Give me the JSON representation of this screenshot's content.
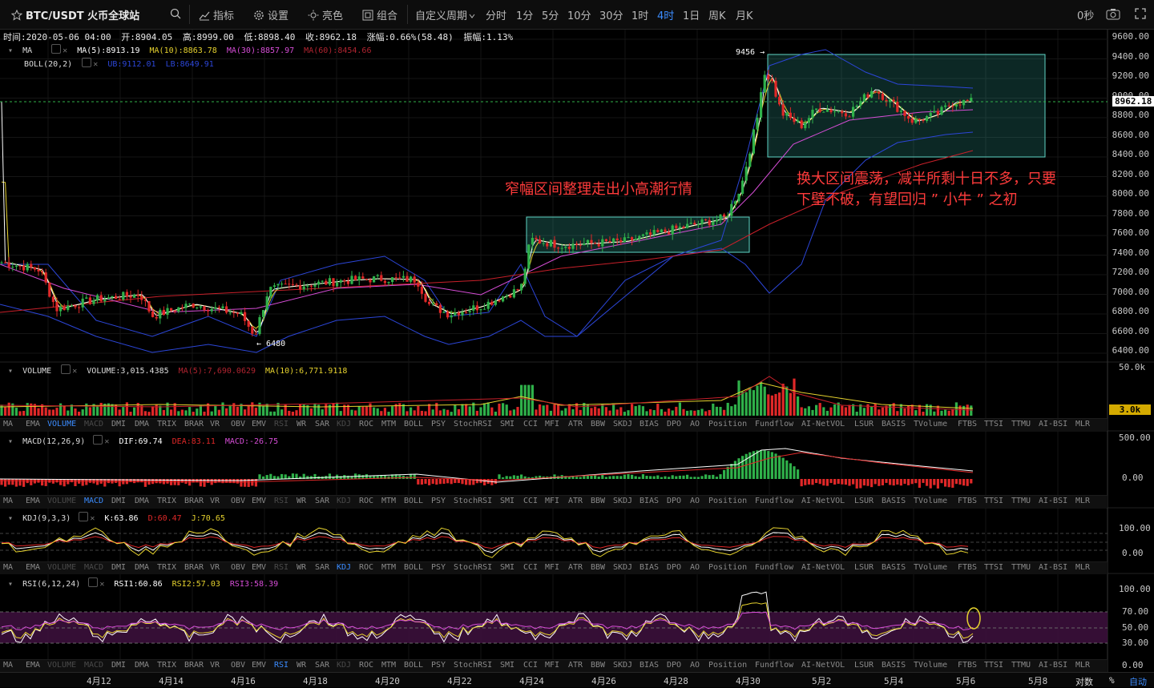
{
  "toolbar": {
    "symbol": "BTC/USDT 火币全球站",
    "indicators": "指标",
    "settings": "设置",
    "theme": "亮色",
    "combo": "组合",
    "custom_period": "自定义周期",
    "periods": [
      "分时",
      "1分",
      "5分",
      "10分",
      "30分",
      "1时",
      "4时",
      "1日",
      "周K",
      "月K"
    ],
    "active_period": "4时",
    "timer": "0秒"
  },
  "ohlc": {
    "time": "时间:2020-05-06 04:00",
    "open": "开:8904.05",
    "high": "高:8999.00",
    "low": "低:8898.40",
    "close": "收:8962.18",
    "change": "涨幅:0.66%(58.48)",
    "amplitude": "振幅:1.13%"
  },
  "ma_legend": {
    "name": "MA",
    "ma5": "MA(5):8913.19",
    "ma10": "MA(10):8863.78",
    "ma30": "MA(30):8857.97",
    "ma60": "MA(60):8454.66"
  },
  "boll_legend": {
    "name": "BOLL(20,2)",
    "ub": "UB:9112.01",
    "lb": "LB:8649.91"
  },
  "price_axis": [
    "9600.00",
    "9400.00",
    "9200.00",
    "9000.00",
    "8800.00",
    "8600.00",
    "8400.00",
    "8200.00",
    "8000.00",
    "7800.00",
    "7600.00",
    "7400.00",
    "7200.00",
    "7000.00",
    "6800.00",
    "6600.00",
    "6400.00"
  ],
  "last_price": "8962.18",
  "high_marker": "9456",
  "low_marker": "6480",
  "annotations": {
    "narrow": "窄幅区间整理走出小高潮行情",
    "wide_line1": "换大区间震荡，减半所剩十日不多，只要",
    "wide_line2": "下壁不破，有望回归 ”  小牛 ”  之初"
  },
  "volume": {
    "name": "VOLUME",
    "value": "VOLUME:3,015.4385",
    "ma5": "MA(5):7,690.0629",
    "ma10": "MA(10):6,771.9118",
    "axis_top": "50.0k",
    "last": "3.0k"
  },
  "macd": {
    "name": "MACD(12,26,9)",
    "dif": "DIF:69.74",
    "dea": "DEA:83.11",
    "macd": "MACD:-26.75",
    "axis": [
      "500.00",
      "0.00"
    ]
  },
  "kdj": {
    "name": "KDJ(9,3,3)",
    "k": "K:63.86",
    "d": "D:60.47",
    "j": "J:70.65",
    "axis": [
      "100.00",
      "0.00"
    ]
  },
  "rsi": {
    "name": "RSI(6,12,24)",
    "rsi1": "RSI1:60.86",
    "rsi2": "RSI2:57.03",
    "rsi3": "RSI3:58.39",
    "axis": [
      "100.00",
      "70.00",
      "50.00",
      "30.00",
      "0.00"
    ]
  },
  "indicator_tabs": [
    "MA",
    "EMA",
    "VOLUME",
    "MACD",
    "DMI",
    "DMA",
    "TRIX",
    "BRAR",
    "VR",
    "OBV",
    "EMV",
    "RSI",
    "WR",
    "SAR",
    "KDJ",
    "ROC",
    "MTM",
    "BOLL",
    "PSY",
    "StochRSI",
    "SMI",
    "CCI",
    "MFI",
    "ATR",
    "BBW",
    "SKDJ",
    "BIAS",
    "DPO",
    "AO",
    "Position",
    "Fundflow",
    "AI-NetVOL",
    "LSUR",
    "BASIS",
    "TVolume",
    "FTBS",
    "TTSI",
    "TTMU",
    "AI-BSI",
    "MLR"
  ],
  "dates": [
    "4月12",
    "4月14",
    "4月16",
    "4月18",
    "4月20",
    "4月22",
    "4月24",
    "4月26",
    "4月28",
    "4月30",
    "5月2",
    "5月4",
    "5月6",
    "5月8"
  ],
  "scale_log": "对数",
  "scale_pct": "%",
  "scale_auto": "自动",
  "colors": {
    "up": "#2fb14a",
    "down": "#e02828",
    "ma5": "#ffffff",
    "ma10": "#e6d22e",
    "ma30": "#d64dd6",
    "ma60": "#c8202a",
    "boll": "#2c46d8",
    "box": "#38b8a8"
  }
}
